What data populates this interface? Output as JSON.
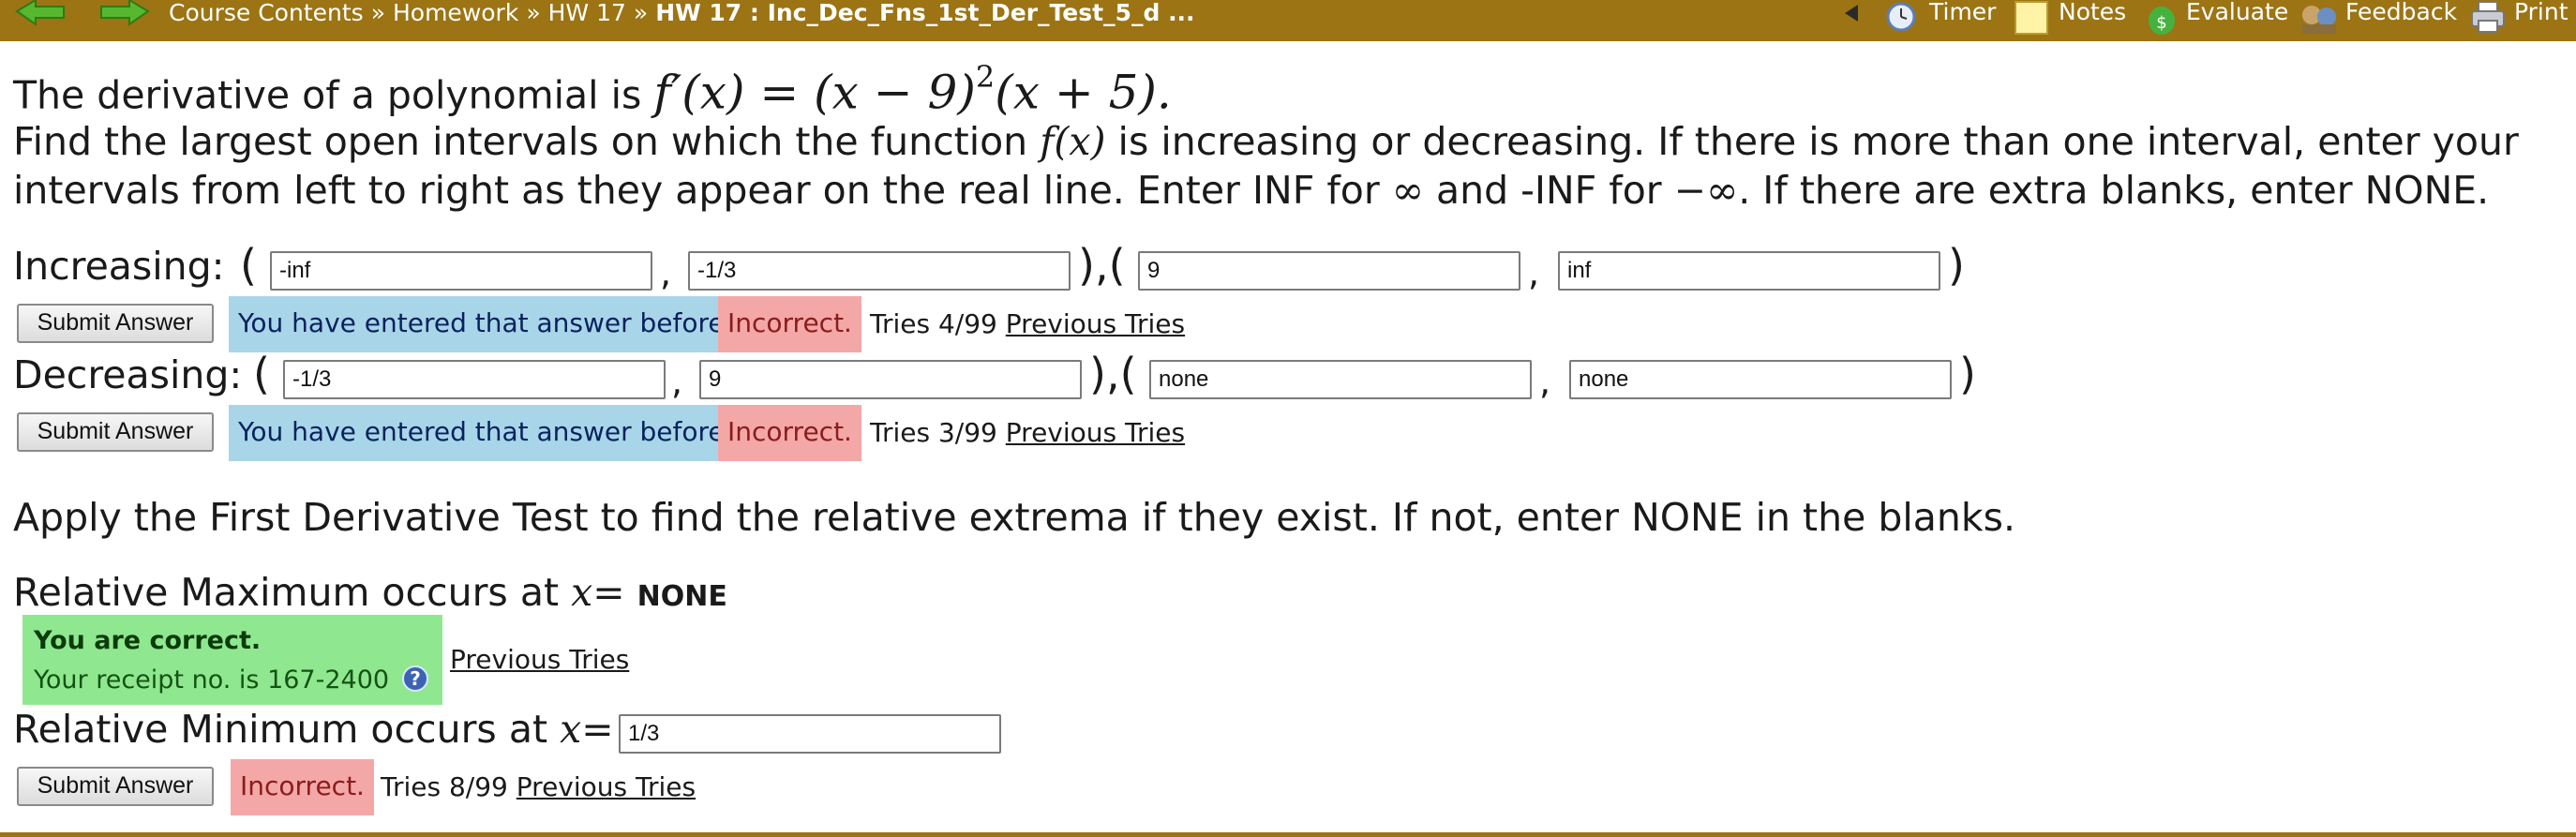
{
  "topbar": {
    "breadcrumb": {
      "course": "Course Contents",
      "homework": "Homework",
      "hw": "HW 17",
      "current": "HW 17 : Inc_Dec_Fns_1st_Der_Test_5_d ...",
      "separator": "»"
    },
    "tools": {
      "timer": "Timer",
      "notes": "Notes",
      "evaluate": "Evaluate",
      "feedback": "Feedback",
      "print": "Print"
    },
    "colors": {
      "bar": "#9c7413",
      "arrow": "#56b82f"
    }
  },
  "problem": {
    "intro": "The derivative of a polynomial is",
    "formula": "f′(x) = (x − 9)",
    "exponent": "2",
    "formula_end": "(x + 5).",
    "instructions_1a": "Find the largest open intervals on which the function",
    "instructions_fx": "f(x)",
    "instructions_1b": "is increasing or decreasing. If there is more than one interval, enter your",
    "instructions_2a": "intervals from left to right as they appear on the real line. Enter INF for",
    "infinity": "∞",
    "instructions_2b": "and -INF for",
    "neg_infinity": "−∞",
    "instructions_2c": ". If there are extra blanks, enter NONE."
  },
  "increasing": {
    "label": "Increasing:",
    "open": "(",
    "comma": ",",
    "mid": "),(",
    "close": ")",
    "fields": [
      "-inf",
      "-1/3",
      "9",
      "inf"
    ],
    "submit": "Submit Answer",
    "status_before": "You have entered that answer before",
    "status_incorrect": "Incorrect.",
    "tries": "Tries 4/99",
    "previous_tries": "Previous Tries"
  },
  "decreasing": {
    "label": "Decreasing:",
    "open": "(",
    "comma": ",",
    "mid": "),(",
    "close": ")",
    "fields": [
      "-1/3",
      "9",
      "none",
      "none"
    ],
    "submit": "Submit Answer",
    "status_before": "You have entered that answer before",
    "status_incorrect": "Incorrect.",
    "tries": "Tries 3/99",
    "previous_tries": "Previous Tries"
  },
  "extrema": {
    "instruction": "Apply the First Derivative Test to find the relative extrema if they exist. If not, enter NONE in the blanks.",
    "max_label": "Relative Maximum occurs at",
    "max_var": "x",
    "equals": "=",
    "max_answer": "NONE",
    "correct_title": "You are correct.",
    "receipt": "Your receipt no. is 167-2400",
    "max_previous_tries": "Previous Tries",
    "min_label": "Relative Minimum occurs at",
    "min_var": "x",
    "min_field": "1/3",
    "min_submit": "Submit Answer",
    "min_status": "Incorrect.",
    "min_tries": "Tries 8/99",
    "min_previous_tries": "Previous Tries"
  }
}
